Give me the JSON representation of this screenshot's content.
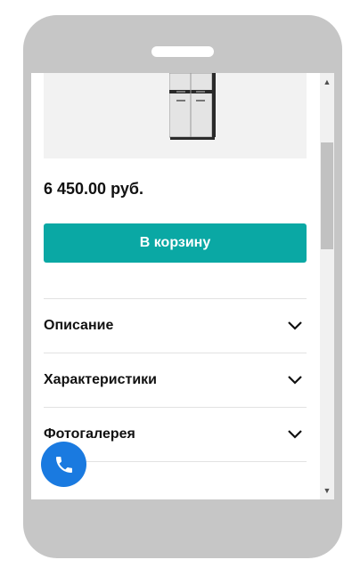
{
  "product": {
    "price": "6 450.00 руб.",
    "cart_button_label": "В корзину",
    "image_icon": "cabinet-image"
  },
  "accordion": [
    {
      "label": "Описание",
      "icon": "chevron-down-icon"
    },
    {
      "label": "Характеристики",
      "icon": "chevron-down-icon"
    },
    {
      "label": "Фотогалерея",
      "icon": "chevron-down-icon"
    }
  ],
  "scrollbar": {
    "up_glyph": "▲",
    "down_glyph": "▼"
  },
  "call_widget": {
    "icon": "phone-icon"
  },
  "colors": {
    "accent": "#0aa8a4",
    "call_button": "#1a7ae0",
    "frame": "#c6c6c6"
  }
}
